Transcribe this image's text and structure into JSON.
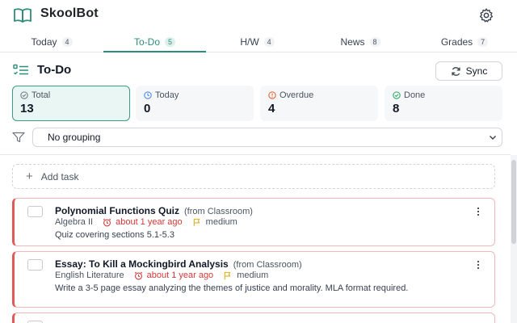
{
  "app": {
    "title": "SkoolBot"
  },
  "tabs": [
    {
      "label": "Today",
      "count": "4"
    },
    {
      "label": "To-Do",
      "count": "5"
    },
    {
      "label": "H/W",
      "count": "4"
    },
    {
      "label": "News",
      "count": "8"
    },
    {
      "label": "Grades",
      "count": "7"
    }
  ],
  "active_tab": "To-Do",
  "page": {
    "title": "To-Do",
    "sync_label": "Sync"
  },
  "stats": [
    {
      "label": "Total",
      "value": "13",
      "icon": "check-circle-icon",
      "color": "#6b7280"
    },
    {
      "label": "Today",
      "value": "0",
      "icon": "clock-icon",
      "color": "#3b82f6"
    },
    {
      "label": "Overdue",
      "value": "4",
      "icon": "alert-circle-icon",
      "color": "#e05a2a"
    },
    {
      "label": "Done",
      "value": "8",
      "icon": "check-circle-icon",
      "color": "#22a35a"
    }
  ],
  "grouping": {
    "selected": "No grouping"
  },
  "add_task": {
    "label": "Add task"
  },
  "tasks": [
    {
      "title": "Polynomial Functions Quiz",
      "source": "(from Classroom)",
      "course": "Algebra II",
      "due": "about 1 year ago",
      "priority": "medium",
      "description": "Quiz covering sections 5.1-5.3"
    },
    {
      "title": "Essay: To Kill a Mockingbird Analysis",
      "source": "(from Classroom)",
      "course": "English Literature",
      "due": "about 1 year ago",
      "priority": "medium",
      "description": "Write a 3-5 page essay analyzing the themes of justice and morality. MLA format required."
    }
  ],
  "colors": {
    "accent": "#2d8c7b",
    "overdue": "#d23a3a",
    "priority": "#e0b021"
  }
}
